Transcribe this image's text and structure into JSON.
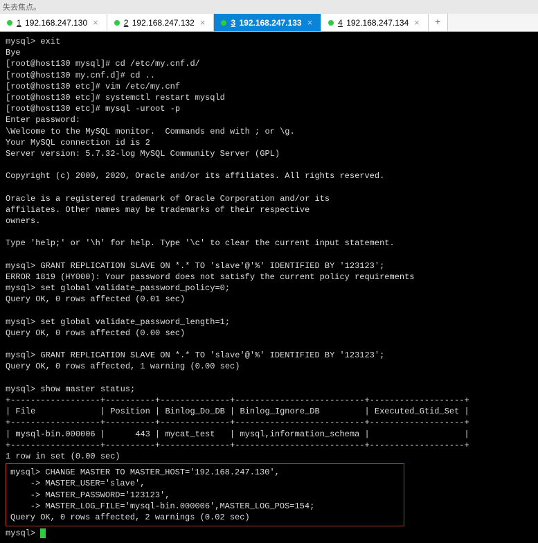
{
  "header": {
    "status_text": "失去焦点。"
  },
  "tabs": [
    {
      "num": "1",
      "label": "192.168.247.130",
      "active": false
    },
    {
      "num": "2",
      "label": "192.168.247.132",
      "active": false
    },
    {
      "num": "3",
      "label": "192.168.247.133",
      "active": true
    },
    {
      "num": "4",
      "label": "192.168.247.134",
      "active": false
    }
  ],
  "terminal": {
    "line01": "mysql> exit",
    "line02": "Bye",
    "line03": "[root@host130 mysql]# cd /etc/my.cnf.d/",
    "line04": "[root@host130 my.cnf.d]# cd ..",
    "line05": "[root@host130 etc]# vim /etc/my.cnf",
    "line06": "[root@host130 etc]# systemctl restart mysqld",
    "line07": "[root@host130 etc]# mysql -uroot -p",
    "line08": "Enter password:",
    "line09": "\\Welcome to the MySQL monitor.  Commands end with ; or \\g.",
    "line10": "Your MySQL connection id is 2",
    "line11": "Server version: 5.7.32-log MySQL Community Server (GPL)",
    "line12": "",
    "line13": "Copyright (c) 2000, 2020, Oracle and/or its affiliates. All rights reserved.",
    "line14": "",
    "line15": "Oracle is a registered trademark of Oracle Corporation and/or its",
    "line16": "affiliates. Other names may be trademarks of their respective",
    "line17": "owners.",
    "line18": "",
    "line19": "Type 'help;' or '\\h' for help. Type '\\c' to clear the current input statement.",
    "line20": "",
    "line21": "mysql> GRANT REPLICATION SLAVE ON *.* TO 'slave'@'%' IDENTIFIED BY '123123';",
    "line22": "ERROR 1819 (HY000): Your password does not satisfy the current policy requirements",
    "line23": "mysql> set global validate_password_policy=0;",
    "line24": "Query OK, 0 rows affected (0.01 sec)",
    "line25": "",
    "line26": "mysql> set global validate_password_length=1;",
    "line27": "Query OK, 0 rows affected (0.00 sec)",
    "line28": "",
    "line29": "mysql> GRANT REPLICATION SLAVE ON *.* TO 'slave'@'%' IDENTIFIED BY '123123';",
    "line30": "Query OK, 0 rows affected, 1 warning (0.00 sec)",
    "line31": "",
    "line32": "mysql> show master status;",
    "line33": "+------------------+----------+--------------+--------------------------+-------------------+",
    "line34": "| File             | Position | Binlog_Do_DB | Binlog_Ignore_DB         | Executed_Gtid_Set |",
    "line35": "+------------------+----------+--------------+--------------------------+-------------------+",
    "line36": "| mysql-bin.000006 |      443 | mycat_test   | mysql,information_schema |                   |",
    "line37": "+------------------+----------+--------------+--------------------------+-------------------+",
    "line38": "1 row in set (0.00 sec)",
    "box": {
      "b1": "mysql> CHANGE MASTER TO MASTER_HOST='192.168.247.130',",
      "b2": "    -> MASTER_USER='slave',",
      "b3": "    -> MASTER_PASSWORD='123123',",
      "b4": "    -> MASTER_LOG_FILE='mysql-bin.000006',MASTER_LOG_POS=154;",
      "b5": "Query OK, 0 rows affected, 2 warnings (0.02 sec)"
    },
    "prompt": "mysql> "
  }
}
